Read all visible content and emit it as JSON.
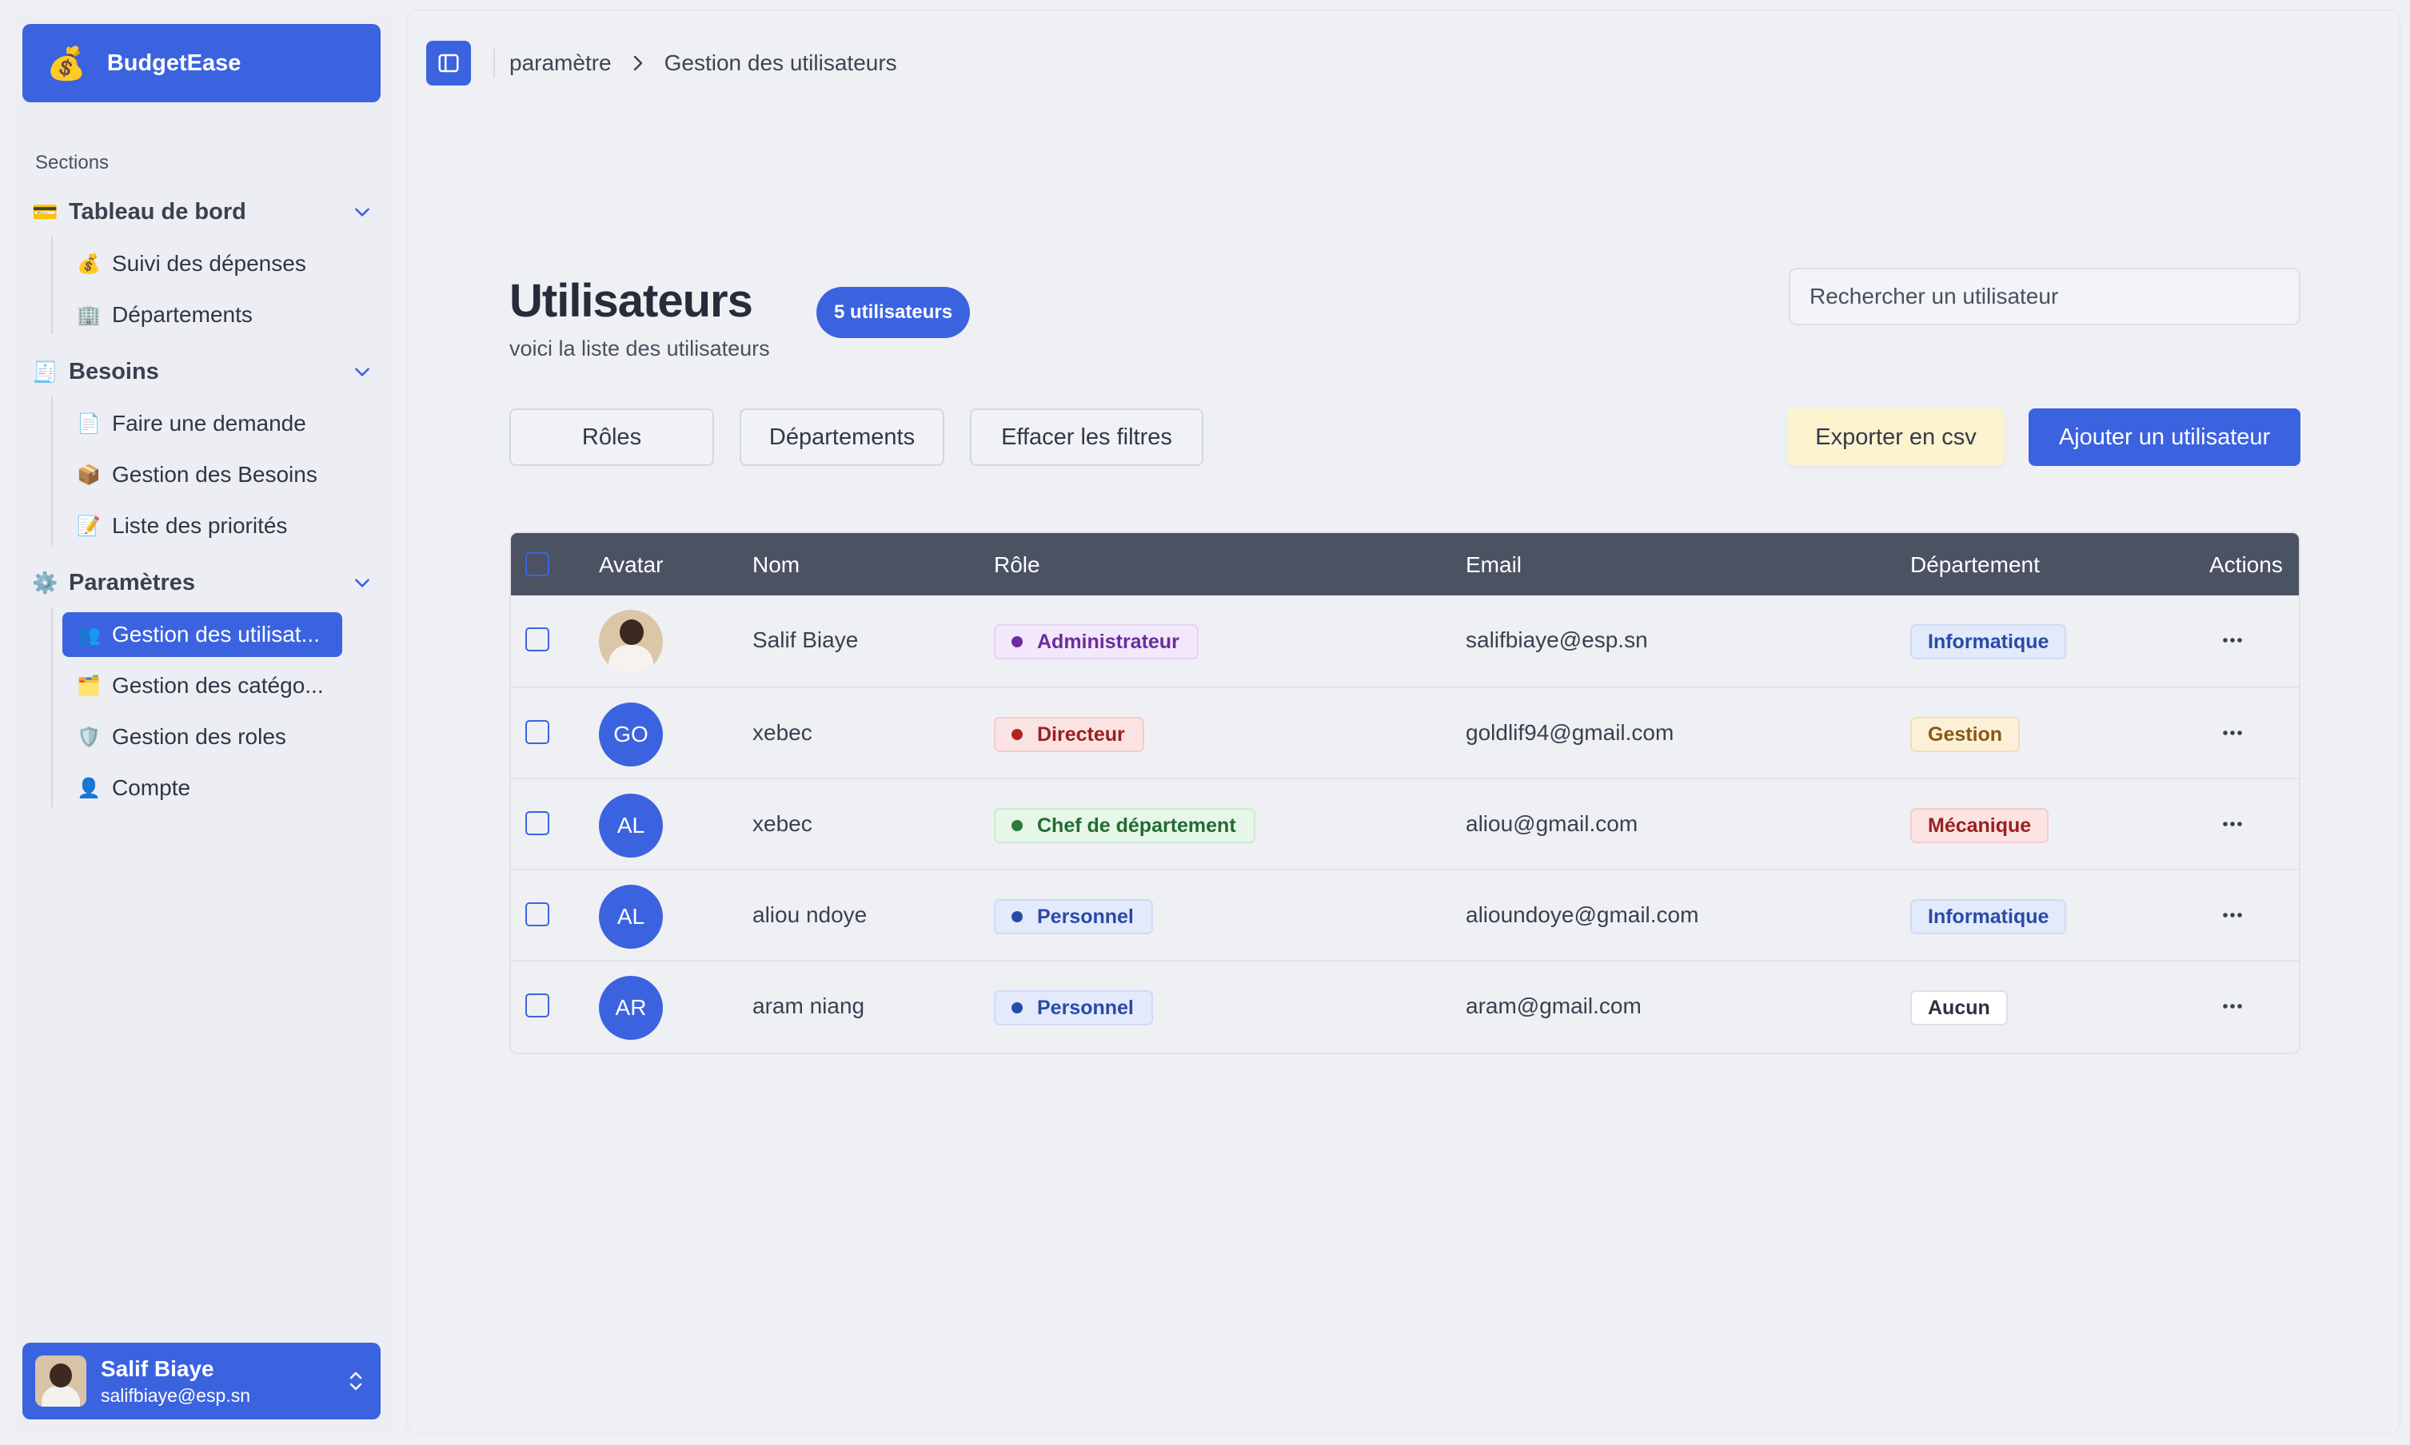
{
  "brand": {
    "name": "BudgetEase",
    "icon": "money-bag-icon",
    "emoji": "💰"
  },
  "sidebar": {
    "sections_label": "Sections",
    "groups": [
      {
        "label": "Tableau de bord",
        "icon": "credit-card-icon",
        "emoji": "💳",
        "items": [
          {
            "label": "Suivi des dépenses",
            "emoji": "💰"
          },
          {
            "label": "Départements",
            "emoji": "🏢"
          }
        ]
      },
      {
        "label": "Besoins",
        "icon": "receipt-icon",
        "emoji": "🧾",
        "items": [
          {
            "label": "Faire une demande",
            "emoji": "📄"
          },
          {
            "label": "Gestion des Besoins",
            "emoji": "📦"
          },
          {
            "label": "Liste des priorités",
            "emoji": "📝"
          }
        ]
      },
      {
        "label": "Paramètres",
        "icon": "gear-icon",
        "emoji": "⚙️",
        "items": [
          {
            "label": "Gestion des utilisat...",
            "emoji": "👥",
            "active": true
          },
          {
            "label": "Gestion des catégo...",
            "emoji": "🗂️"
          },
          {
            "label": "Gestion des roles",
            "emoji": "🛡️"
          },
          {
            "label": "Compte",
            "emoji": "👤"
          }
        ]
      }
    ]
  },
  "current_user": {
    "name": "Salif Biaye",
    "email": "salifbiaye@esp.sn"
  },
  "breadcrumb": {
    "parent": "paramètre",
    "current": "Gestion des utilisateurs"
  },
  "page": {
    "title": "Utilisateurs",
    "subtitle": "voici la liste des utilisateurs",
    "count_badge": "5 utilisateurs"
  },
  "search": {
    "placeholder": "Rechercher un utilisateur",
    "value": ""
  },
  "filters": {
    "roles": "Rôles",
    "departments": "Départements",
    "clear": "Effacer les filtres"
  },
  "actions": {
    "export": "Exporter en csv",
    "add": "Ajouter un utilisateur"
  },
  "table": {
    "columns": [
      "Avatar",
      "Nom",
      "Rôle",
      "Email",
      "Département",
      "Actions"
    ],
    "rows": [
      {
        "avatar": "",
        "photo": true,
        "name": "Salif Biaye",
        "role": "Administrateur",
        "email": "salifbiaye@esp.sn",
        "department": "Informatique"
      },
      {
        "avatar": "GO",
        "photo": false,
        "name": "xebec",
        "role": "Directeur",
        "email": "goldlif94@gmail.com",
        "department": "Gestion"
      },
      {
        "avatar": "AL",
        "photo": false,
        "name": "xebec",
        "role": "Chef de département",
        "email": "aliou@gmail.com",
        "department": "Mécanique"
      },
      {
        "avatar": "AL",
        "photo": false,
        "name": "aliou ndoye",
        "role": "Personnel",
        "email": "alioundoye@gmail.com",
        "department": "Informatique"
      },
      {
        "avatar": "AR",
        "photo": false,
        "name": "aram niang",
        "role": "Personnel",
        "email": "aram@gmail.com",
        "department": "Aucun"
      }
    ]
  },
  "colors": {
    "accent": "#3b63e0",
    "table_header": "#4b5262",
    "role": {
      "Administrateur": {
        "bg": "#f3e8fb",
        "border": "#e6d3f3",
        "fg": "#6b2ca0",
        "dot": "#6b2ca0"
      },
      "Directeur": {
        "bg": "#fbe3e3",
        "border": "#f3cccc",
        "fg": "#9a1f1f",
        "dot": "#b42323"
      },
      "Chef de département": {
        "bg": "#e6f6e8",
        "border": "#cdebd2",
        "fg": "#226b32",
        "dot": "#2a7a3b"
      },
      "Personnel": {
        "bg": "#e2eafb",
        "border": "#cfdbf5",
        "fg": "#2a4aa8",
        "dot": "#2a4aa8"
      }
    },
    "department": {
      "Informatique": {
        "bg": "#e2eafb",
        "border": "#cfdbf5",
        "fg": "#2a4aa8"
      },
      "Gestion": {
        "bg": "#fcf1d8",
        "border": "#f2dfb3",
        "fg": "#8a5a12"
      },
      "Mécanique": {
        "bg": "#fbe3e3",
        "border": "#f3cccc",
        "fg": "#9a1f1f"
      },
      "Aucun": {
        "bg": "#ffffff",
        "border": "#dcdfe6",
        "fg": "#2b3242"
      }
    }
  }
}
